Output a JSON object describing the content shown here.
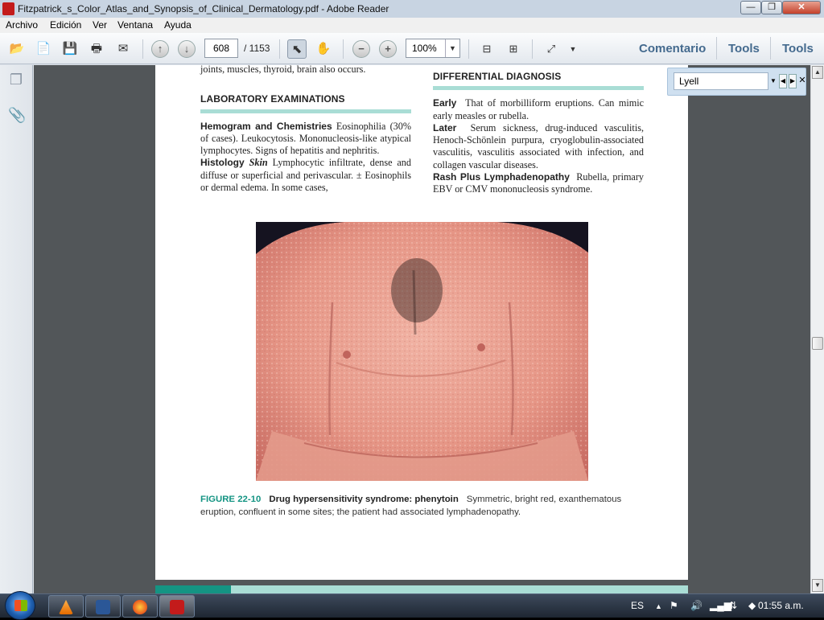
{
  "window": {
    "title": "Fitzpatrick_s_Color_Atlas_and_Synopsis_of_Clinical_Dermatology.pdf - Adobe Reader",
    "minimize": "—",
    "restore": "❐",
    "close": "✕"
  },
  "menu": {
    "items": [
      "Archivo",
      "Edición",
      "Ver",
      "Ventana",
      "Ayuda"
    ]
  },
  "toolbar": {
    "page_current": "608",
    "page_total": "/ 1153",
    "zoom": "100%",
    "comentario": "Comentario",
    "tools1": "Tools",
    "tools2": "Tools"
  },
  "search": {
    "value": "Lyell"
  },
  "document": {
    "top_line": "joints, muscles, thyroid, brain also occurs.",
    "lab_heading": "LABORATORY EXAMINATIONS",
    "hemogram_label": "Hemogram and Chemistries",
    "hemogram_text": "Eosinophilia (30% of cases). Leukocytosis. Mononucleosis-like atypical lymphocytes. Signs of hepatitis and nephritis.",
    "histology_label": "Histology",
    "histology_sub": "Skin",
    "histology_text": "Lymphocytic infiltrate, dense and diffuse or superficial and perivascular. ± Eosinophils or dermal edema. In some cases,",
    "dd_heading": "DIFFERENTIAL DIAGNOSIS",
    "early_label": "Early",
    "early_text": "That of morbilliform eruptions. Can mimic early measles or rubella.",
    "later_label": "Later",
    "later_text": "Serum sickness, drug-induced vasculitis, Henoch-Schönlein purpura, cryoglobulin-associated vasculitis, vasculitis associated with infection, and collagen vascular diseases.",
    "rash_label": "Rash Plus Lymphadenopathy",
    "rash_text": "Rubella, primary EBV or CMV mononucleosis syndrome.",
    "figure_number": "FIGURE 22-10",
    "figure_title": "Drug hypersensitivity syndrome: phenytoin",
    "figure_text": "Symmetric, bright red, exanthematous eruption, confluent in some sites; the patient had associated lymphadenopathy."
  },
  "taskbar": {
    "lang": "ES",
    "time": "01:55 a.m."
  },
  "colors": {
    "accent_teal": "#149483",
    "rule_teal": "#a9ddd5",
    "link_blue": "#446a8e"
  },
  "icons": [
    "open-icon",
    "create-pdf-icon",
    "save-icon",
    "print-icon",
    "email-icon",
    "prev-page-icon",
    "next-page-icon",
    "select-tool-icon",
    "hand-tool-icon",
    "zoom-out-icon",
    "zoom-in-icon",
    "fit-width-icon",
    "fit-page-icon",
    "fullscreen-icon",
    "pages-panel-icon",
    "attachments-icon"
  ]
}
